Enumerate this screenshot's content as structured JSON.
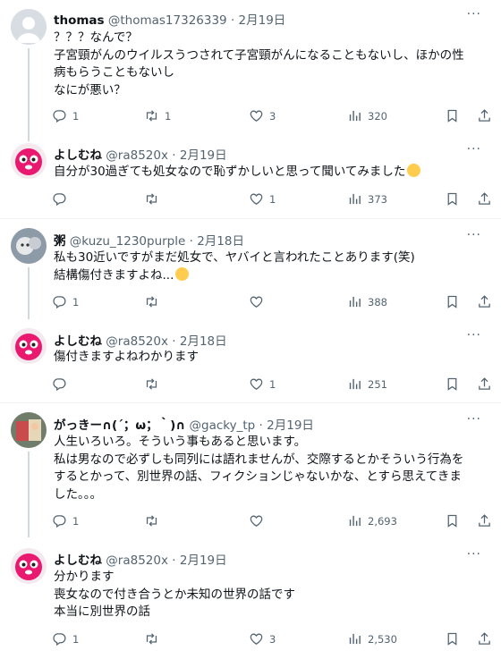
{
  "tweets": [
    {
      "name": "thomas",
      "handle": "@thomas17326339",
      "date": "2月19日",
      "lines": [
        "？？？なんで？",
        "子宮頸がんのウイルスうつされて子宮頸がんになることもないし、ほかの性",
        "病もらうこともないし",
        "なにが悪い？"
      ],
      "replies": "1",
      "retweets": "1",
      "likes": "3",
      "views": "320"
    },
    {
      "name": "よしむね",
      "handle": "@ra8520x",
      "date": "2月19日",
      "lines": [
        "自分が30過ぎても処女なので恥ずかしいと思って聞いてみました"
      ],
      "replies": "",
      "retweets": "",
      "likes": "1",
      "views": "373"
    },
    {
      "name": "粥",
      "handle": "@kuzu_1230purple",
      "date": "2月18日",
      "lines": [
        "私も30近いですがまだ処女で、ヤバイと言われたことあります(笑)",
        "結構傷付きますよね..."
      ],
      "replies": "1",
      "retweets": "",
      "likes": "",
      "views": "388"
    },
    {
      "name": "よしむね",
      "handle": "@ra8520x",
      "date": "2月18日",
      "lines": [
        "傷付きますよねわかります"
      ],
      "replies": "",
      "retweets": "",
      "likes": "1",
      "views": "251"
    },
    {
      "name": "がっきー∩(´；ω；｀)∩",
      "handle": "@gacky_tp",
      "date": "2月19日",
      "lines": [
        "人生いろいろ。そういう事もあると思います。",
        "私は男なので必ずしも同列には語れませんが、交際するとかそういう行為を",
        "するとかって、別世界の話、フィクションじゃないかな、とすら思えてきま",
        "した。。。"
      ],
      "replies": "1",
      "retweets": "",
      "likes": "",
      "views": "2,693"
    },
    {
      "name": "よしむね",
      "handle": "@ra8520x",
      "date": "2月19日",
      "lines": [
        "分かります",
        "喪女なので付き合うとか未知の世界の話です",
        "本当に別世界の話"
      ],
      "replies": "1",
      "retweets": "",
      "likes": "3",
      "views": "2,530"
    }
  ],
  "icons": {
    "reply": "reply-icon",
    "retweet": "retweet-icon",
    "like": "heart-icon",
    "views": "views-icon",
    "bookmark": "bookmark-icon",
    "share": "share-icon",
    "more": "more-icon"
  },
  "colors": {
    "text": "#0f1419",
    "secondary": "#536471",
    "separator": "#eff3f4",
    "thread_line": "#cfd9de",
    "avatar_pink": "#e8196f"
  }
}
